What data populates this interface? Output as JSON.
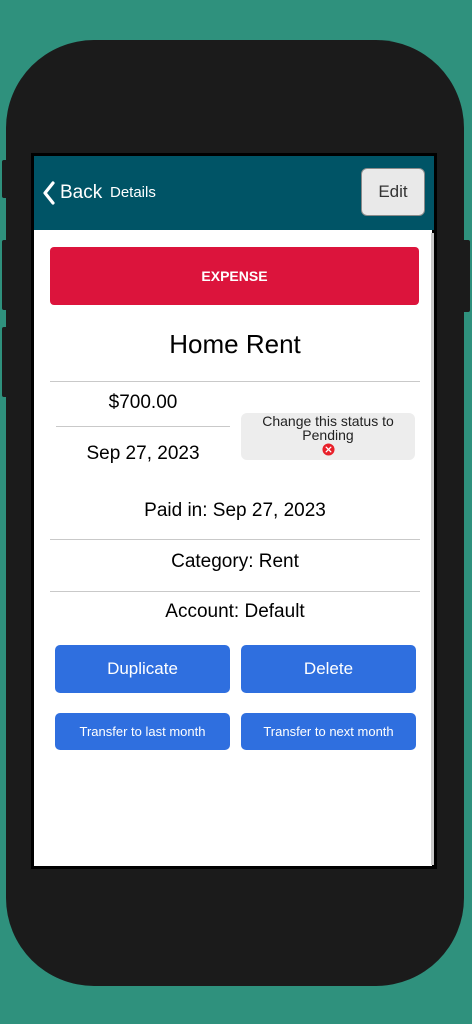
{
  "header": {
    "back_label": "Back",
    "title": "Details",
    "edit_label": "Edit"
  },
  "transaction": {
    "type": "EXPENSE",
    "name": "Home Rent",
    "amount": "$700.00",
    "date": "Sep 27, 2023",
    "status_action_line1": "Change this status to",
    "status_action_line2": "Pending",
    "paid_in": "Paid in: Sep 27, 2023",
    "category": "Category: Rent",
    "account": "Account: Default"
  },
  "actions": {
    "duplicate": "Duplicate",
    "delete": "Delete",
    "transfer_last": "Transfer to last month",
    "transfer_next": "Transfer to next month"
  },
  "colors": {
    "background": "#2f917d",
    "header": "#005466",
    "expense": "#dc143c",
    "primary_button": "#2f6fdf",
    "status_icon": "#e8202a"
  },
  "icons": {
    "back": "chevron-left-icon",
    "status": "close-circle-icon"
  }
}
